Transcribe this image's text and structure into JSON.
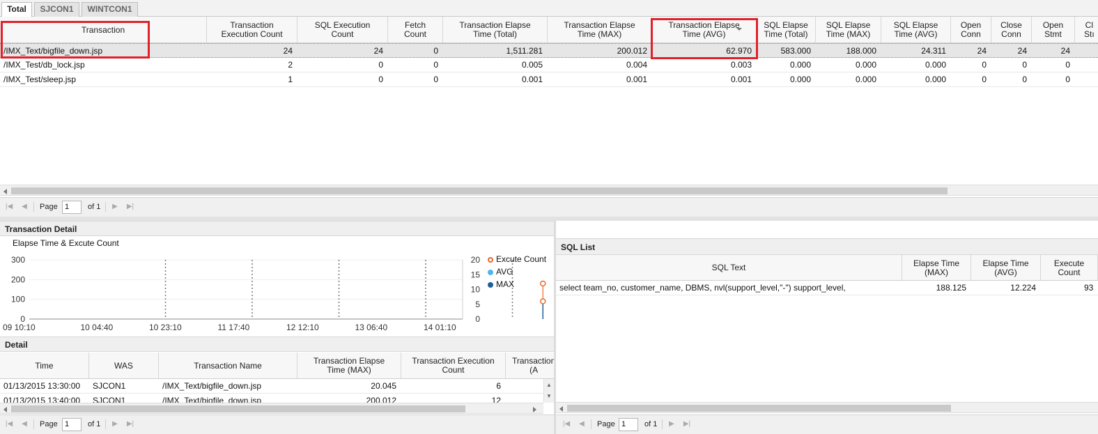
{
  "tabs": [
    {
      "label": "Total",
      "active": true
    },
    {
      "label": "SJCON1",
      "active": false
    },
    {
      "label": "WINTCON1",
      "active": false
    }
  ],
  "main_table": {
    "columns": [
      "Transaction",
      "Transaction\nExecution Count",
      "SQL Execution\nCount",
      "Fetch\nCount",
      "Transaction Elapse\nTime (Total)",
      "Transaction Elapse\nTime (MAX)",
      "Transaction Elapse\nTime (AVG)",
      "SQL Elapse\nTime (Total)",
      "SQL Elapse\nTime (MAX)",
      "SQL Elapse\nTime (AVG)",
      "Open\nConn",
      "Close\nConn",
      "Open\nStmt",
      "Cl\nStı"
    ],
    "sorted_column": "Transaction Elapse Time (AVG)",
    "rows": [
      [
        "/IMX_Text/bigfile_down.jsp",
        "24",
        "24",
        "0",
        "1,511.281",
        "200.012",
        "62.970",
        "583.000",
        "188.000",
        "24.311",
        "24",
        "24",
        "24",
        ""
      ],
      [
        "/IMX_Test/db_lock.jsp",
        "2",
        "0",
        "0",
        "0.005",
        "0.004",
        "0.003",
        "0.000",
        "0.000",
        "0.000",
        "0",
        "0",
        "0",
        ""
      ],
      [
        "/IMX_Test/sleep.jsp",
        "1",
        "0",
        "0",
        "0.001",
        "0.001",
        "0.001",
        "0.000",
        "0.000",
        "0.000",
        "0",
        "0",
        "0",
        ""
      ]
    ],
    "highlight_color": "#e1202a"
  },
  "pager_main": {
    "page_label": "Page",
    "page_value": "1",
    "of_label": "of 1"
  },
  "transaction_detail": {
    "title": "Transaction Detail",
    "chart_title": "Elapse Time & Excute Count"
  },
  "chart_data": {
    "type": "line",
    "title": "Elapse Time & Excute Count",
    "x_ticks": [
      "09 10:10",
      "10 04:40",
      "10 23:10",
      "11 17:40",
      "12 12:10",
      "13 06:40",
      "14 01:10"
    ],
    "y_left_ticks": [
      "0",
      "100",
      "200",
      "300"
    ],
    "y_right_ticks": [
      "0",
      "5",
      "10",
      "15",
      "20"
    ],
    "ylim_left": [
      0,
      300
    ],
    "ylim_right": [
      0,
      20
    ],
    "legend": [
      {
        "name": "Excute Count",
        "color": "#e8672a"
      },
      {
        "name": "AVG",
        "color": "#4fb6e8"
      },
      {
        "name": "MAX",
        "color": "#1f5f96"
      }
    ],
    "series": [
      {
        "name": "Excute Count",
        "axis": "right",
        "points": [
          {
            "x": 6.36,
            "y": 12
          },
          {
            "x": 6.36,
            "y": 6
          },
          {
            "x": 6.81,
            "y": 6
          }
        ]
      },
      {
        "name": "MAX",
        "axis": "left",
        "points": [
          {
            "x": 6.36,
            "y": 20
          }
        ]
      },
      {
        "name": "AVG",
        "axis": "left",
        "points": [
          {
            "x": 6.81,
            "y": 15
          }
        ]
      }
    ]
  },
  "detail": {
    "title": "Detail",
    "columns": [
      "Time",
      "WAS",
      "Transaction Name",
      "Transaction Elapse\nTime (MAX)",
      "Transaction Execution\nCount",
      "Transaction\n(A"
    ],
    "rows": [
      [
        "01/13/2015 13:30:00",
        "SJCON1",
        "/IMX_Text/bigfile_down.jsp",
        "20.045",
        "6",
        ""
      ],
      [
        "01/13/2015 13:40:00",
        "SJCON1",
        "/IMX_Text/bigfile_down.jsp",
        "200.012",
        "12",
        ""
      ]
    ]
  },
  "pager_detail": {
    "page_label": "Page",
    "page_value": "1",
    "of_label": "of 1"
  },
  "sql_list": {
    "title": "SQL List",
    "columns": [
      "SQL Text",
      "Elapse Time\n(MAX)",
      "Elapse Time\n(AVG)",
      "Execute\nCount"
    ],
    "rows": [
      [
        "select team_no, customer_name, DBMS, nvl(support_level,\"-\") support_level,",
        "188.125",
        "12.224",
        "93"
      ]
    ]
  },
  "pager_sql": {
    "page_label": "Page",
    "page_value": "1",
    "of_label": "of 1"
  }
}
